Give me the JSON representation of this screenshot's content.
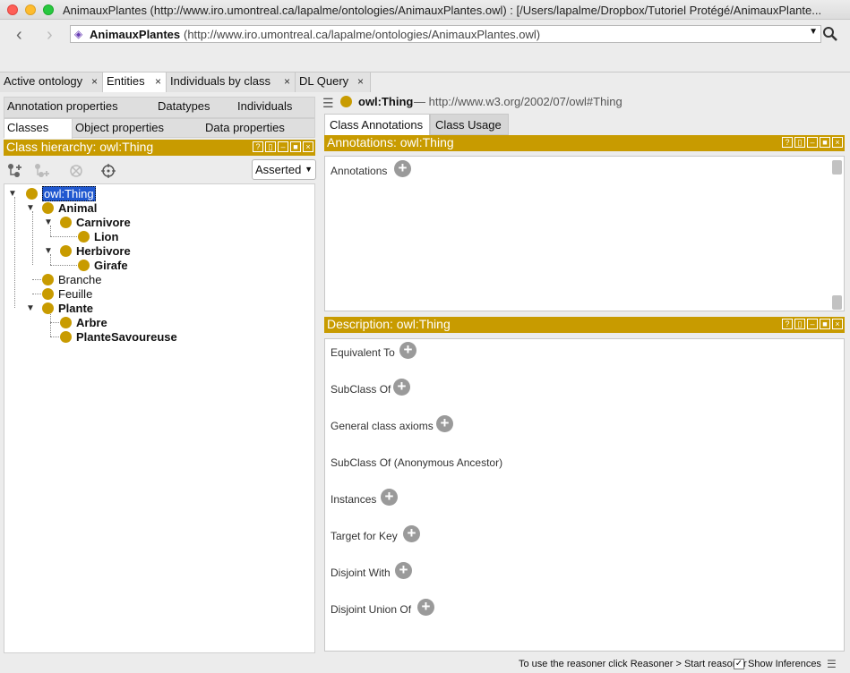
{
  "window": {
    "title": "AnimauxPlantes (http://www.iro.umontreal.ca/lapalme/ontologies/AnimauxPlantes.owl)  : [/Users/lapalme/Dropbox/Tutoriel Protégé/AnimauxPlante..."
  },
  "toolbar": {
    "back_icon": "‹",
    "forward_icon": "›",
    "ontology_name": "AnimauxPlantes",
    "ontology_url": "(http://www.iro.umontreal.ca/lapalme/ontologies/AnimauxPlantes.owl)",
    "search_icon": "⚲"
  },
  "tabs": [
    {
      "label": "Active ontology"
    },
    {
      "label": "Entities"
    },
    {
      "label": "Individuals by class"
    },
    {
      "label": "DL Query"
    }
  ],
  "left": {
    "subtabs_row1": [
      "Annotation properties",
      "Datatypes",
      "Individuals"
    ],
    "subtabs_row2": [
      "Classes",
      "Object properties",
      "Data properties"
    ],
    "hierarchy_title": "Class hierarchy: owl:Thing",
    "view_select": "Asserted",
    "tree": [
      {
        "label": "owl:Thing",
        "depth": 0,
        "expanded": true,
        "selected": true
      },
      {
        "label": "Animal",
        "depth": 1,
        "expanded": true,
        "bold": true
      },
      {
        "label": "Carnivore",
        "depth": 2,
        "expanded": true,
        "bold": true
      },
      {
        "label": "Lion",
        "depth": 3,
        "bold": true
      },
      {
        "label": "Herbivore",
        "depth": 2,
        "expanded": true,
        "bold": true
      },
      {
        "label": "Girafe",
        "depth": 3,
        "bold": true
      },
      {
        "label": "Branche",
        "depth": 1
      },
      {
        "label": "Feuille",
        "depth": 1
      },
      {
        "label": "Plante",
        "depth": 1,
        "expanded": true,
        "bold": true
      },
      {
        "label": "Arbre",
        "depth": 2,
        "bold": true
      },
      {
        "label": "PlanteSavoureuse",
        "depth": 2,
        "bold": true
      }
    ]
  },
  "right": {
    "entity_name": "owl:Thing",
    "entity_iri": "— http://www.w3.org/2002/07/owl#Thing",
    "tabs": [
      "Class Annotations",
      "Class Usage"
    ],
    "annotations_title": "Annotations: owl:Thing",
    "annotations_label": "Annotations",
    "description_title": "Description: owl:Thing",
    "description_sections": [
      {
        "label": "Equivalent To",
        "plus": true
      },
      {
        "label": "SubClass Of",
        "plus": true
      },
      {
        "label": "General class axioms",
        "plus": true
      },
      {
        "label": "SubClass Of (Anonymous Ancestor)",
        "plus": false
      },
      {
        "label": "Instances",
        "plus": true
      },
      {
        "label": "Target for Key",
        "plus": true
      },
      {
        "label": "Disjoint With",
        "plus": true
      },
      {
        "label": "Disjoint Union Of",
        "plus": true
      }
    ]
  },
  "status": {
    "message": "To use the reasoner click Reasoner > Start reasoner",
    "show_inferences_label": "Show Inferences",
    "show_inferences_checked": true
  },
  "colors": {
    "accent_gold": "#c89b00",
    "selection_blue": "#2058d0"
  }
}
